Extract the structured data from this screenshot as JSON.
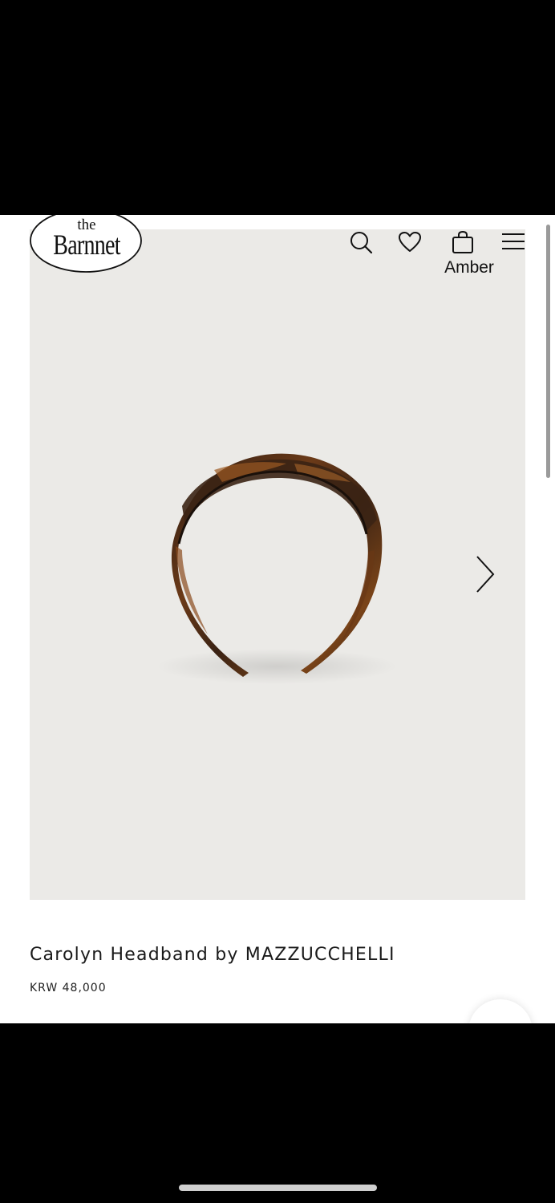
{
  "brand": {
    "small": "the",
    "name": "Barnnet"
  },
  "header": {
    "icons": [
      "search-icon",
      "heart-icon",
      "bag-icon",
      "menu-icon"
    ],
    "variant_label": "Amber"
  },
  "product": {
    "title": "Carolyn Headband by MAZZUCCHELLI",
    "price": "KRW 48,000",
    "image": "tortoiseshell-headband"
  },
  "colors": {
    "page_bg": "#ffffff",
    "image_bg": "#ebeae7",
    "text": "#1a1a1a",
    "frame": "#000000"
  }
}
